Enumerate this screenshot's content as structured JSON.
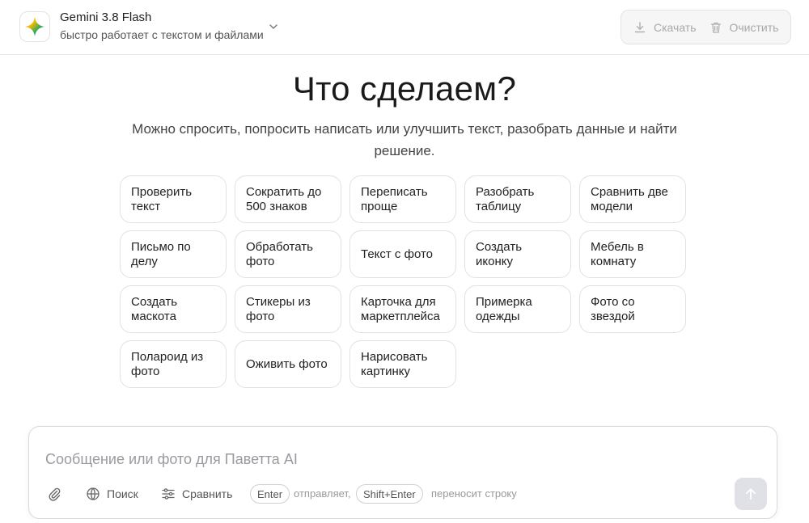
{
  "header": {
    "model_name": "Gemini 3.8 Flash",
    "model_desc": "быстро работает с текстом и файлами",
    "download_label": "Скачать",
    "clear_label": "Очистить"
  },
  "hero": {
    "title": "Что сделаем?",
    "subtitle": "Можно спросить, попросить написать или улучшить текст, разобрать данные и найти решение."
  },
  "chips": [
    "Проверить текст",
    "Сократить до 500 знаков",
    "Переписать проще",
    "Разобрать таблицу",
    "Сравнить две модели",
    "Письмо по делу",
    "Обработать фото",
    "Текст с фото",
    "Создать иконку",
    "Мебель в комнату",
    "Создать маскота",
    "Стикеры из фото",
    "Карточка для маркетплейса",
    "Примерка одежды",
    "Фото со звездой",
    "Полароид из фото",
    "Оживить фото",
    "Нарисовать картинку"
  ],
  "composer": {
    "placeholder": "Сообщение или фото для Паветта AI",
    "search_label": "Поиск",
    "compare_label": "Сравнить",
    "enter_key": "Enter",
    "enter_hint": "отправляет,",
    "shift_enter_key": "Shift+Enter",
    "shift_enter_hint": "переносит строку"
  },
  "colors": {
    "accent_disabled": "#dfe1e6",
    "muted_text": "#a8a8ad"
  },
  "icons": {
    "logo": "gemini-sparkle-icon",
    "download": "download-icon",
    "clear": "trash-icon",
    "attach": "paperclip-icon",
    "search": "globe-icon",
    "compare": "sliders-icon",
    "send": "arrow-up-icon"
  }
}
